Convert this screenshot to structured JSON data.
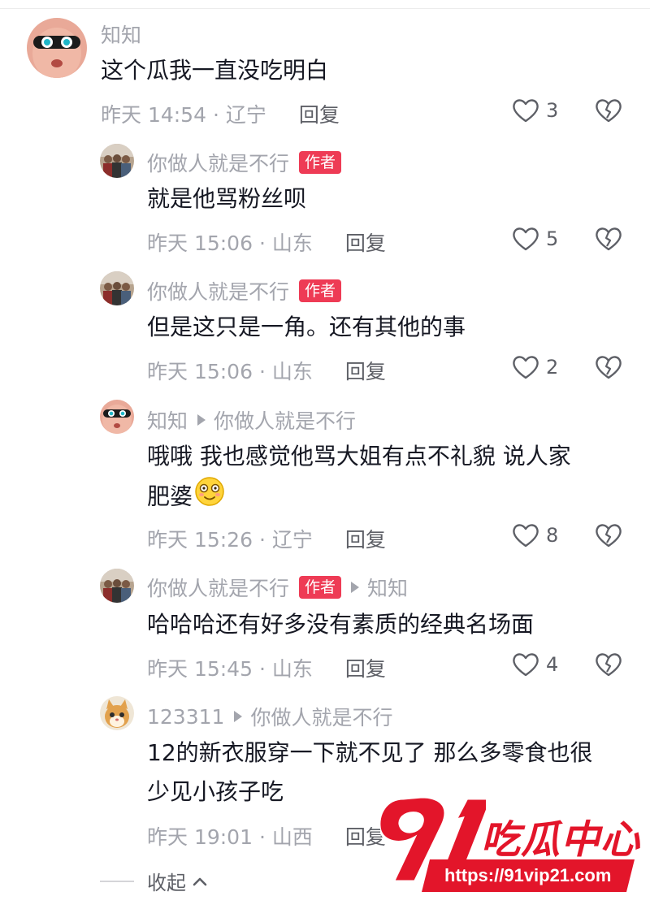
{
  "comments": [
    {
      "user": "知知",
      "text": "这个瓜我一直没吃明白",
      "meta": "昨天 14:54 · 辽宁",
      "reply_label": "回复",
      "likes": "3"
    }
  ],
  "replies": [
    {
      "user": "你做人就是不行",
      "author_tag": "作者",
      "text": "就是他骂粉丝呗",
      "meta": "昨天 15:06 · 山东",
      "reply_label": "回复",
      "likes": "5"
    },
    {
      "user": "你做人就是不行",
      "author_tag": "作者",
      "text": "但是这只是一角。还有其他的事",
      "meta": "昨天 15:06 · 山东",
      "reply_label": "回复",
      "likes": "2"
    },
    {
      "user": "知知",
      "reply_to": "你做人就是不行",
      "text_line1": "哦哦 我也感觉他骂大姐有点不礼貌 说人家",
      "text_line2": "肥婆",
      "meta": "昨天 15:26 · 辽宁",
      "reply_label": "回复",
      "likes": "8"
    },
    {
      "user": "你做人就是不行",
      "author_tag": "作者",
      "reply_to": "知知",
      "text": "哈哈哈还有好多没有素质的经典名场面",
      "meta": "昨天 15:45 · 山东",
      "reply_label": "回复",
      "likes": "4"
    },
    {
      "user": "123311",
      "reply_to": "你做人就是不行",
      "text_line1": "12的新衣服穿一下就不见了 那么多零食也很",
      "text_line2": "少见小孩子吃",
      "meta": "昨天 19:01 · 山西",
      "reply_label": "回复"
    }
  ],
  "collapse_label": "收起",
  "watermark": {
    "number": "91",
    "name": "吃瓜中心",
    "url": "https://91vip21.com"
  },
  "colors": {
    "author_tag": "#ee3b55",
    "muted": "#a3a5ad",
    "watermark": "#e3152a"
  }
}
